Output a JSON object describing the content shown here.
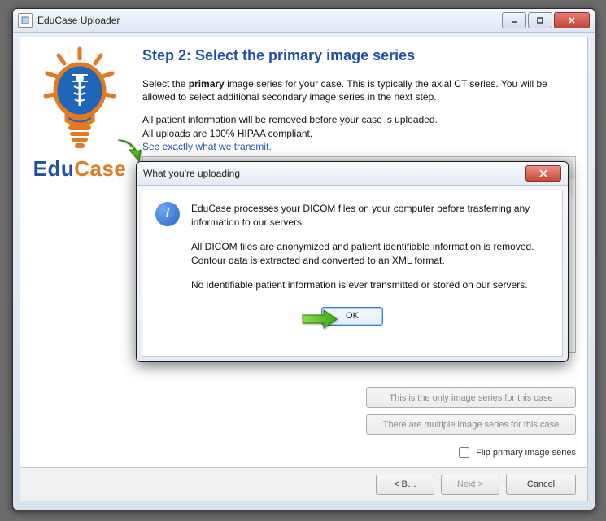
{
  "window": {
    "title": "EduCase Uploader"
  },
  "brand": {
    "edu": "Edu",
    "case": "Case"
  },
  "step": {
    "heading": "Step 2: Select the primary image series",
    "intro_pre": "Select the ",
    "intro_bold": "primary",
    "intro_post": " image series for your case. This is typically the axial CT series. You will be allowed to select additional secondary image series in the next step.",
    "line2": "All patient information will be removed before your case is uploaded.",
    "line3": "All uploads are 100% HIPAA compliant.",
    "link": "See exactly what we transmit."
  },
  "options": {
    "only_series": "This is the only image series for this case",
    "multi_series": "There are multiple image series for this case",
    "flip_label": "Flip primary image series"
  },
  "footer": {
    "back": "< B…",
    "next": "Next >",
    "cancel": "Cancel"
  },
  "dialog": {
    "title": "What you're uploading",
    "p1": "EduCase processes your DICOM files on your computer before trasferring any information to our servers.",
    "p2": "All DICOM files are anonymized and patient identifiable information is removed. Contour data is extracted and converted to an XML format.",
    "p3": "No identifiable patient information is ever transmitted or stored on our servers.",
    "ok": "OK"
  }
}
